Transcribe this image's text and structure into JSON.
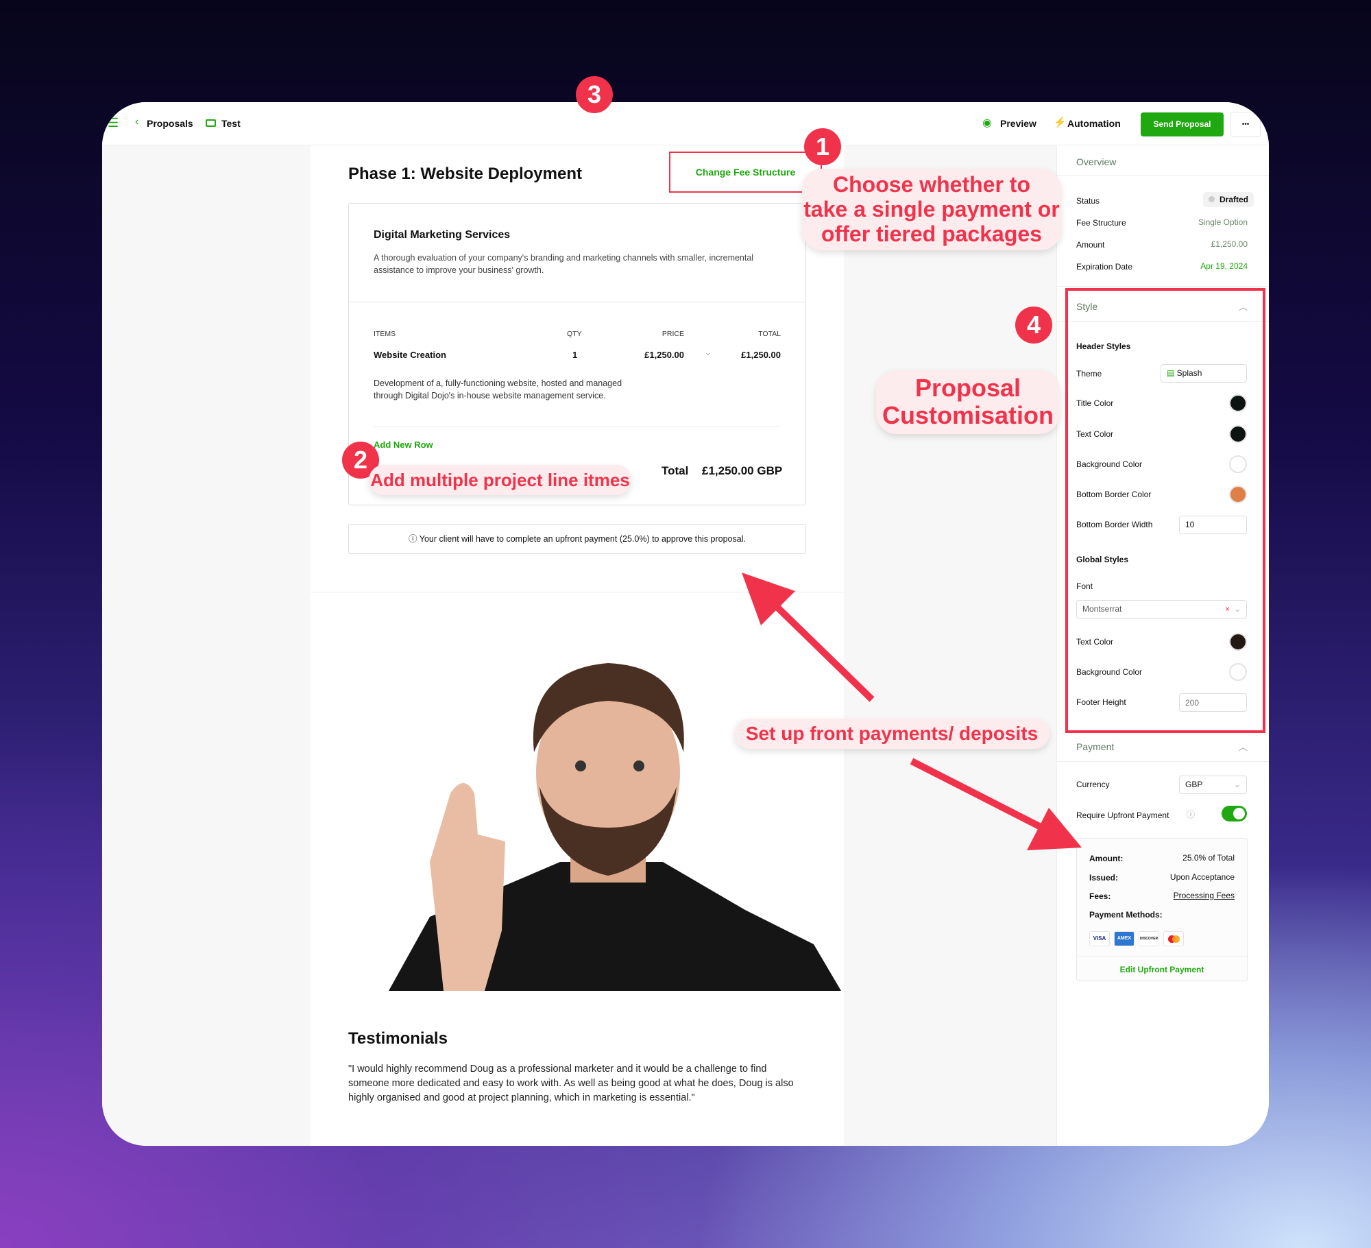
{
  "topbar": {
    "breadcrumb_back": "Proposals",
    "folder": "Test",
    "preview": "Preview",
    "automation": "Automation",
    "send": "Send Proposal",
    "more": "•••"
  },
  "phase": {
    "title": "Phase 1: Website Deployment",
    "change_fee": "Change Fee Structure"
  },
  "service": {
    "title": "Digital Marketing Services",
    "description": "A thorough evaluation of your company's branding and marketing channels with smaller, incremental assistance to improve your business' growth.",
    "columns": [
      "ITEMS",
      "QTY",
      "PRICE",
      "TOTAL"
    ],
    "rows": [
      {
        "item": "Website Creation",
        "qty": "1",
        "price": "£1,250.00",
        "total": "£1,250.00",
        "description": "Development of a, fully-functioning website, hosted and managed through Digital Dojo's in-house website management service."
      }
    ],
    "add_row": "Add New Row",
    "total_label": "Total",
    "total_value": "£1,250.00 GBP"
  },
  "upfront_notice": "Your client will have to complete an upfront payment (25.0%) to approve this proposal.",
  "testimonials": {
    "title": "Testimonials",
    "quote": "\"I would highly recommend Doug as a professional marketer and it would be a challenge to find someone more dedicated and easy to work with. As well as being good at what he does, Doug is also highly organised and good at project planning, which in marketing is essential.\""
  },
  "overview": {
    "title": "Overview",
    "status_label": "Status",
    "status": "Drafted",
    "fee_label": "Fee Structure",
    "fee": "Single Option",
    "amount_label": "Amount",
    "amount": "£1,250.00",
    "exp_label": "Expiration Date",
    "exp": "Apr 19, 2024"
  },
  "style": {
    "title": "Style",
    "header_styles": "Header Styles",
    "theme_label": "Theme",
    "theme": "Splash",
    "title_color": "Title Color",
    "text_color": "Text Color",
    "bg_color": "Background Color",
    "border_color": "Bottom Border Color",
    "border_width_label": "Bottom Border Width",
    "border_width": "10",
    "global_styles": "Global Styles",
    "font_label": "Font",
    "font": "Montserrat",
    "g_text_color": "Text Color",
    "g_bg_color": "Background Color",
    "footer_label": "Footer Height",
    "footer_placeholder": "200",
    "colors": {
      "title": "#0b1410",
      "text": "#0b1410",
      "background": "#ffffff",
      "border": "#e07f45",
      "global_text": "#231812",
      "global_bg": "#ffffff"
    }
  },
  "payment": {
    "title": "Payment",
    "currency_label": "Currency",
    "currency": "GBP",
    "upfront_label": "Require Upfront Payment",
    "upfront_on": true,
    "amount_label": "Amount:",
    "amount": "25.0% of Total",
    "issued_label": "Issued:",
    "issued": "Upon Acceptance",
    "fees_label": "Fees:",
    "fees": "Processing Fees",
    "methods_label": "Payment Methods:",
    "methods": [
      "VISA",
      "AMEX",
      "DISCOVER",
      "Mastercard"
    ],
    "edit": "Edit Upfront Payment"
  },
  "annotations": {
    "n1": "1",
    "n2": "2",
    "n3": "3",
    "n4": "4",
    "a1": [
      "Choose whether to",
      "take a single payment or",
      "offer tiered packages"
    ],
    "a2": "Add multiple project line itmes",
    "a3": "Set up front payments/ deposits",
    "a4": [
      "Proposal",
      "Customisation"
    ]
  },
  "colors": {
    "accent": "#1fa80f",
    "annotation": "#f0334a"
  }
}
